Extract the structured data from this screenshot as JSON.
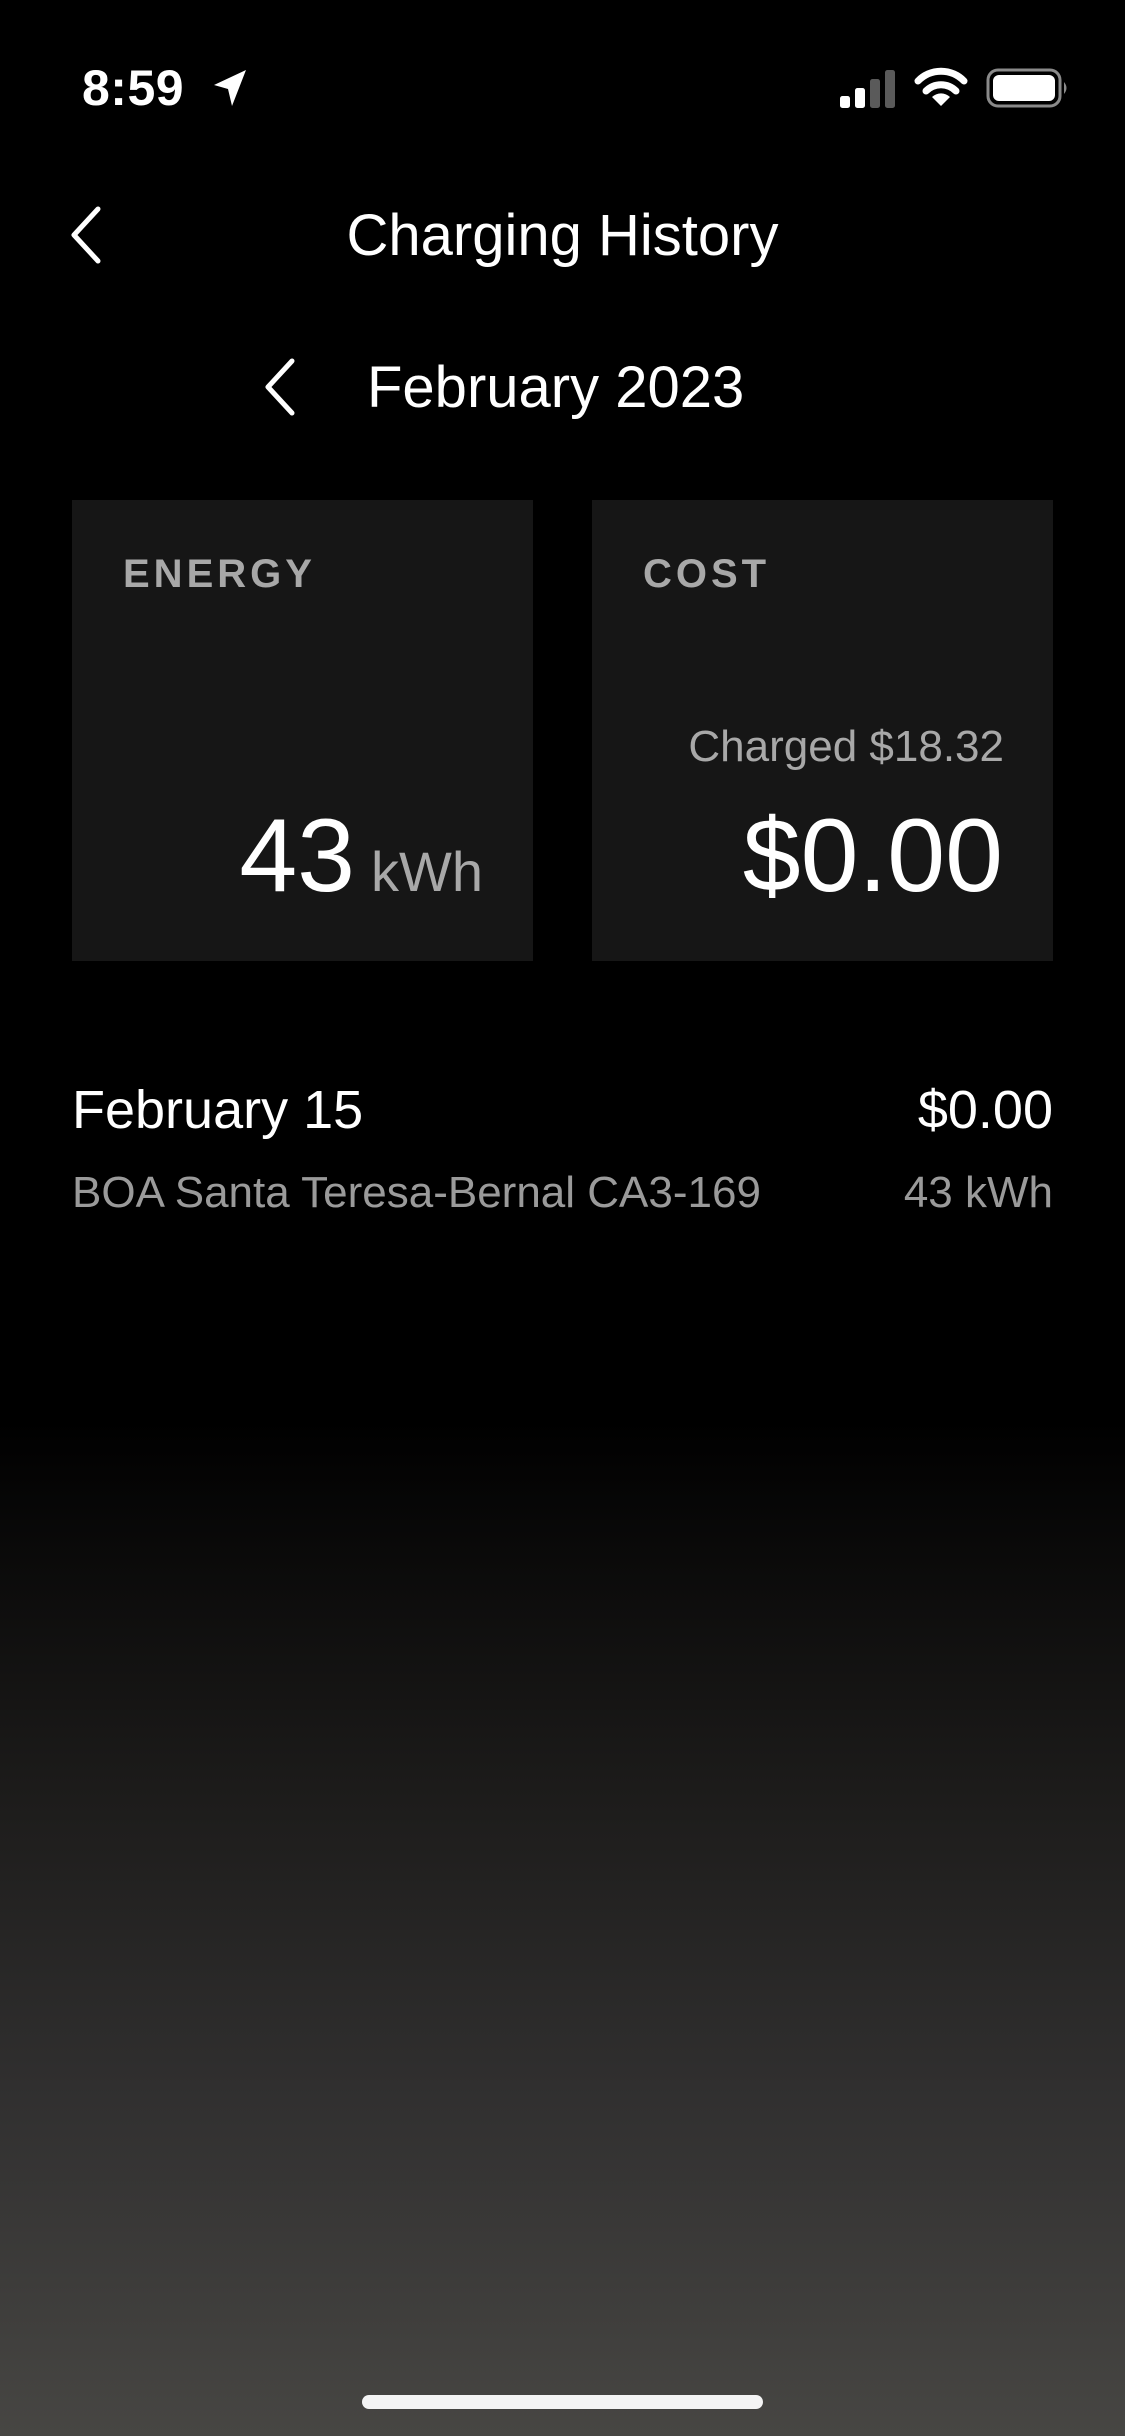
{
  "status_bar": {
    "time": "8:59",
    "icons": [
      "location-arrow-icon",
      "cellular-signal-icon",
      "wifi-icon",
      "battery-icon"
    ]
  },
  "header": {
    "title": "Charging History",
    "back_icon": "chevron-left-icon"
  },
  "month_selector": {
    "label": "February 2023",
    "prev_icon": "chevron-left-icon"
  },
  "summary": {
    "energy": {
      "label": "ENERGY",
      "value": "43",
      "unit": "kWh"
    },
    "cost": {
      "label": "COST",
      "charged": "Charged $18.32",
      "value": "$0.00"
    }
  },
  "sessions": [
    {
      "date": "February 15",
      "cost": "$0.00",
      "location": "BOA Santa Teresa-Bernal CA3-169",
      "energy": "43 kWh"
    }
  ],
  "colors": {
    "background": "#000000",
    "card": "#161616",
    "text_primary": "#ffffff",
    "text_secondary": "#a8a8a8"
  }
}
